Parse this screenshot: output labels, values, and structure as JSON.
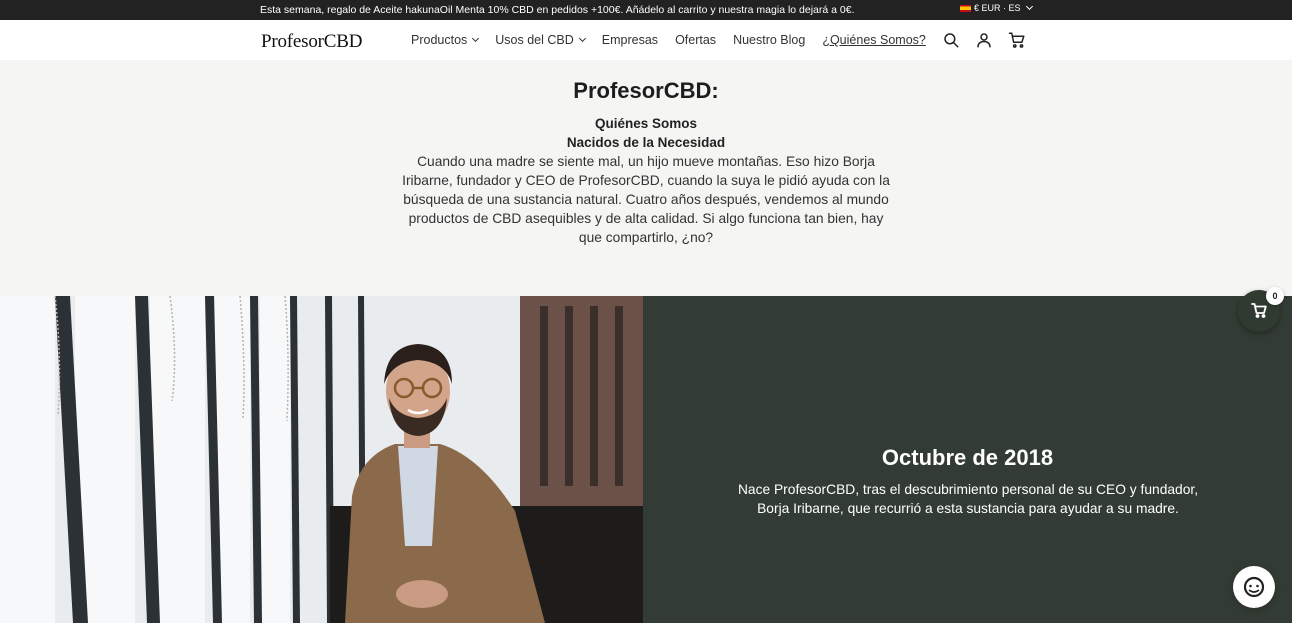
{
  "announcement": {
    "text": "Esta semana, regalo de Aceite hakunaOil Menta 10% CBD en pedidos +100€. Añádelo al carrito y nuestra magia lo dejará a 0€.",
    "locale": "€ EUR · ES"
  },
  "header": {
    "logo": "ProfesorCBD",
    "nav": [
      {
        "label": "Productos"
      },
      {
        "label": "Usos del CBD"
      },
      {
        "label": "Empresas"
      },
      {
        "label": "Ofertas"
      },
      {
        "label": "Nuestro Blog"
      },
      {
        "label": "¿Quiénes Somos?"
      }
    ],
    "icons": [
      "search-icon",
      "account-icon",
      "cart-icon"
    ]
  },
  "intro": {
    "title": "ProfesorCBD:",
    "subtitle_1": "Quiénes Somos",
    "subtitle_2": "Nacidos de la Necesidad",
    "body": "Cuando una madre se siente mal, un hijo mueve montañas. Eso hizo Borja Iribarne, fundador y CEO de ProfesorCBD, cuando la suya le pidió ayuda con la búsqueda de una sustancia natural. Cuatro años después, vendemos al mundo productos de CBD asequibles y de alta calidad. Si algo funciona tan bien, hay que compartirlo, ¿no?"
  },
  "timeline": {
    "title": "Octubre de 2018",
    "body": "Nace ProfesorCBD, tras el descubrimiento personal de su CEO y fundador, Borja Iribarne, que recurrió a esta sustancia para ayudar a su madre."
  },
  "floating": {
    "cart_count": "0"
  },
  "colors": {
    "announcement_bg": "#222222",
    "panel_green": "#333c34",
    "page_bg": "#f5f5f3"
  }
}
